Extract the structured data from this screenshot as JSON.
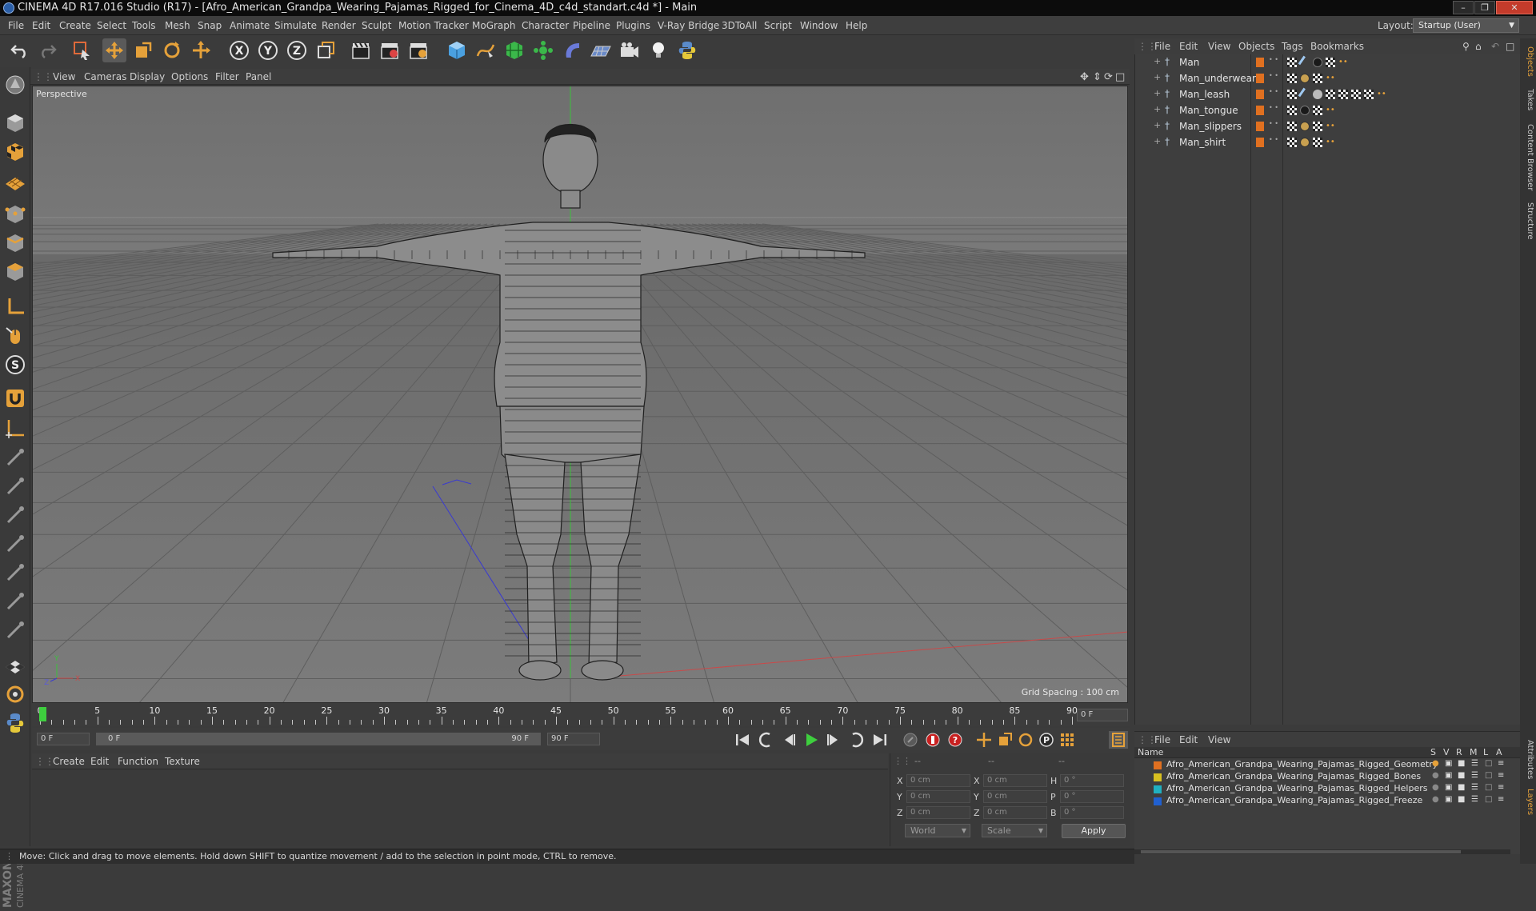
{
  "window": {
    "title": "CINEMA 4D R17.016 Studio (R17) - [Afro_American_Grandpa_Wearing_Pajamas_Rigged_for_Cinema_4D_c4d_standart.c4d *] - Main"
  },
  "menu": [
    "File",
    "Edit",
    "Create",
    "Select",
    "Tools",
    "Mesh",
    "Snap",
    "Animate",
    "Simulate",
    "Render",
    "Sculpt",
    "Motion Tracker",
    "MoGraph",
    "Character",
    "Pipeline",
    "Plugins",
    "V-Ray Bridge",
    "3DToAll",
    "Script",
    "Window",
    "Help"
  ],
  "layout": {
    "label": "Layout:",
    "value": "Startup (User)"
  },
  "viewport": {
    "menu": [
      "View",
      "Cameras",
      "Display",
      "Options",
      "Filter",
      "Panel"
    ],
    "camera_label": "Perspective",
    "grid_spacing": "Grid Spacing : 100 cm"
  },
  "timeline": {
    "ticks": [
      "0",
      "5",
      "10",
      "15",
      "20",
      "25",
      "30",
      "35",
      "40",
      "45",
      "50",
      "55",
      "60",
      "65",
      "70",
      "75",
      "80",
      "85",
      "90"
    ],
    "current_frame": "0 F",
    "start_frame": "0 F",
    "range_start": "0 F",
    "range_end": "90 F",
    "end_frame": "90 F"
  },
  "material_manager": {
    "menu": [
      "Create",
      "Edit",
      "Function",
      "Texture"
    ]
  },
  "coordinates": {
    "header": [
      "--",
      "--",
      "--"
    ],
    "rows": [
      {
        "pos_label": "X",
        "pos": "0 cm",
        "size_label": "X",
        "size": "0 cm",
        "rot_label": "H",
        "rot": "0 °"
      },
      {
        "pos_label": "Y",
        "pos": "0 cm",
        "size_label": "Y",
        "size": "0 cm",
        "rot_label": "P",
        "rot": "0 °"
      },
      {
        "pos_label": "Z",
        "pos": "0 cm",
        "size_label": "Z",
        "size": "0 cm",
        "rot_label": "B",
        "rot": "0 °"
      }
    ],
    "coord_system": "World",
    "mode": "Scale",
    "apply_label": "Apply"
  },
  "object_manager": {
    "menu": [
      "File",
      "Edit",
      "View",
      "Objects",
      "Tags",
      "Bookmarks"
    ],
    "objects": [
      "Man",
      "Man_underwear",
      "Man_leash",
      "Man_tongue",
      "Man_slippers",
      "Man_shirt"
    ]
  },
  "layer_manager": {
    "menu": [
      "File",
      "Edit",
      "View"
    ],
    "columns": {
      "name": "Name",
      "s": "S",
      "v": "V",
      "r": "R",
      "m": "M",
      "l": "L",
      "a": "A"
    },
    "layers": [
      {
        "name": "Afro_American_Grandpa_Wearing_Pajamas_Rigged_Geometry",
        "color": "#e07020"
      },
      {
        "name": "Afro_American_Grandpa_Wearing_Pajamas_Rigged_Bones",
        "color": "#d8c020"
      },
      {
        "name": "Afro_American_Grandpa_Wearing_Pajamas_Rigged_Helpers",
        "color": "#20b0c0"
      },
      {
        "name": "Afro_American_Grandpa_Wearing_Pajamas_Rigged_Freeze",
        "color": "#2060d0"
      }
    ]
  },
  "right_tabs": [
    "Objects",
    "Takes",
    "Content Browser",
    "Structure",
    "Attributes",
    "Layers"
  ],
  "status": "Move: Click and drag to move elements. Hold down SHIFT to quantize movement / add to the selection in point mode, CTRL to remove.",
  "logo": {
    "brand": "MAXON",
    "product": "CINEMA 4D"
  },
  "colors": {
    "accent_orange": "#e5a13a",
    "play_green": "#3ecf3e",
    "axis_x": "#d24040",
    "axis_y": "#3cbf3c",
    "axis_z": "#3a3ad0"
  }
}
